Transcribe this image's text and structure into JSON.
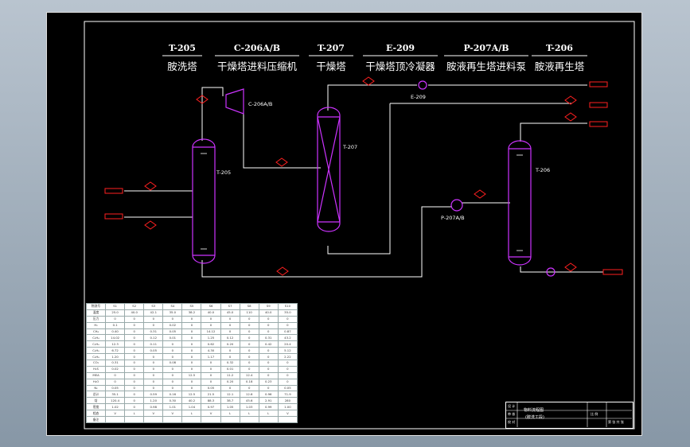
{
  "headers": [
    {
      "tag": "T-205",
      "name": "胺洗塔"
    },
    {
      "tag": "C-206A/B",
      "name": "干燥塔进料压缩机"
    },
    {
      "tag": "T-207",
      "name": "干燥塔"
    },
    {
      "tag": "E-209",
      "name": "干燥塔顶冷凝器"
    },
    {
      "tag": "P-207A/B",
      "name": "胺液再生塔进料泵"
    },
    {
      "tag": "T-206",
      "name": "胺液再生塔"
    }
  ],
  "equipment_labels": {
    "c206": "C-206A/B",
    "t205": "T-205",
    "t207": "T-207",
    "e209": "E-209",
    "p207": "P-207A/B",
    "t206": "T-206"
  },
  "colors": {
    "pipe": "#ffffff",
    "vessel": "#cc33ff",
    "marker": "#ff2020",
    "background": "#000000"
  },
  "table": {
    "rows": [
      [
        "物流号",
        "S1",
        "S2",
        "S3",
        "S4",
        "S5",
        "S6",
        "S7",
        "S8",
        "S9",
        "S10"
      ],
      [
        "温度",
        "25.0",
        "40.0",
        "42.1",
        "35.0",
        "38.2",
        "40.0",
        "45.0",
        "110",
        "40.0",
        "35.0"
      ],
      [
        "压力",
        "0",
        "0",
        "0",
        "0",
        "0",
        "0",
        "0",
        "0",
        "0",
        "0"
      ],
      [
        "H₂",
        "0.1",
        "0",
        "0",
        "0.02",
        "0",
        "0",
        "0",
        "0",
        "0",
        "0"
      ],
      [
        "CH₄",
        "0.40",
        "0",
        "0.31",
        "0.05",
        "0",
        "14.12",
        "0",
        "0",
        "0",
        "0.87"
      ],
      [
        "C₂H₄",
        "14.02",
        "0",
        "0.12",
        "0.01",
        "0",
        "1.25",
        "0.12",
        "0",
        "0.31",
        "43.2"
      ],
      [
        "C₂H₆",
        "12.3",
        "0",
        "0.11",
        "0",
        "0",
        "0.62",
        "0.20",
        "0",
        "0.42",
        "20.4"
      ],
      [
        "C₃H₆",
        "6.72",
        "0",
        "0.05",
        "0",
        "0",
        "4.30",
        "0",
        "0",
        "0",
        "5.12"
      ],
      [
        "C₃H₈",
        "1.20",
        "0",
        "0",
        "0",
        "0",
        "1.17",
        "0",
        "0",
        "0",
        "2.22"
      ],
      [
        "CO₂",
        "0.31",
        "0",
        "0",
        "0.08",
        "0",
        "0",
        "0.32",
        "0",
        "0",
        "0"
      ],
      [
        "H₂S",
        "0.02",
        "0",
        "0",
        "0",
        "0",
        "0",
        "0.01",
        "0",
        "0",
        "0"
      ],
      [
        "MEA",
        "0",
        "0",
        "0",
        "0",
        "12.5",
        "0",
        "11.2",
        "12.4",
        "0",
        "0"
      ],
      [
        "H₂O",
        "0",
        "0",
        "0",
        "0",
        "0",
        "0",
        "0.20",
        "0.18",
        "0.23",
        "0"
      ],
      [
        "N₂",
        "0.05",
        "0",
        "0",
        "0",
        "0",
        "0.05",
        "0",
        "0",
        "0",
        "0.05"
      ],
      [
        "总计",
        "35.1",
        "0",
        "0.59",
        "0.16",
        "12.5",
        "21.5",
        "12.1",
        "12.6",
        "0.96",
        "71.9"
      ],
      [
        "焓",
        "120.4",
        "0",
        "1.20",
        "0.30",
        "40.2",
        "88.3",
        "38.7",
        "45.6",
        "2.91",
        "280"
      ],
      [
        "密度",
        "1.02",
        "0",
        "0.98",
        "1.01",
        "1.04",
        "0.97",
        "1.05",
        "1.03",
        "0.99",
        "1.00"
      ],
      [
        "相态",
        "V",
        "L",
        "V",
        "V",
        "L",
        "V",
        "L",
        "L",
        "L",
        "V"
      ],
      [
        "备注",
        "",
        "",
        "",
        "",
        "",
        "",
        "",
        "",
        "",
        ""
      ]
    ]
  },
  "title_block": {
    "title": "物料流程图",
    "subtitle": "(胺洗工段)",
    "rows": [
      "设 计",
      "审 核",
      "校 对"
    ],
    "scale": "比 例",
    "sheet": "第 张 共 张"
  }
}
